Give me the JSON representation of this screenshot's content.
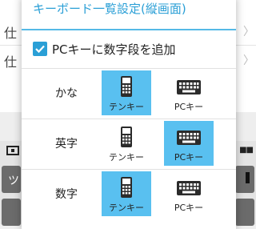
{
  "background": {
    "row1_label": "仕",
    "row2_label": "仕",
    "row_mark": "〉",
    "key_label": "ツ",
    "dots": "■■"
  },
  "dialog": {
    "title": "キーボード一覧設定(縦画面)",
    "option": {
      "label": "PCキーに数字段を追加",
      "checked": true
    },
    "rows": [
      {
        "label": "かな",
        "selected": "tenkey"
      },
      {
        "label": "英字",
        "selected": "pc"
      },
      {
        "label": "数字",
        "selected": "tenkey"
      }
    ],
    "tenkey_label": "テンキー",
    "pc_label": "PCキー",
    "icons": {
      "tenkey": "phone-keypad-icon",
      "pc": "keyboard-icon"
    }
  },
  "colors": {
    "accent": "#2a9fd6",
    "selected_bg": "#59c0f0"
  }
}
